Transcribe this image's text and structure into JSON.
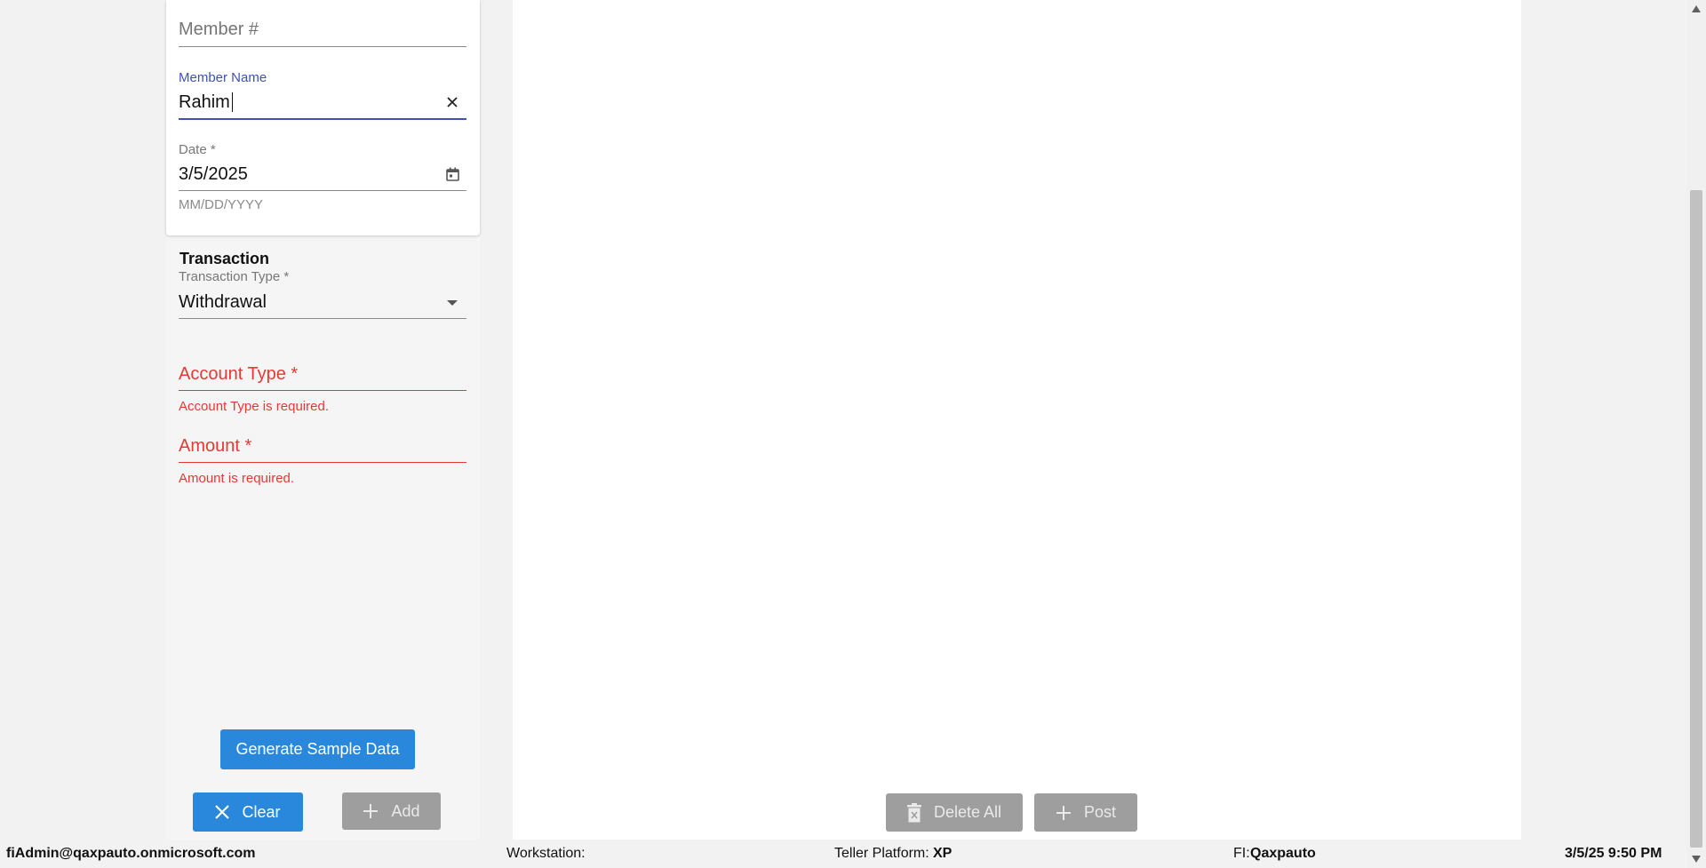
{
  "form": {
    "member_number": {
      "placeholder": "Member #"
    },
    "member_name": {
      "label": "Member Name",
      "value": "Rahim"
    },
    "date": {
      "label": "Date *",
      "value": "3/5/2025",
      "hint": "MM/DD/YYYY"
    }
  },
  "transaction": {
    "title": "Transaction",
    "type": {
      "label": "Transaction Type *",
      "value": "Withdrawal"
    },
    "account_type": {
      "placeholder": "Account Type *",
      "error": "Account Type is required."
    },
    "amount": {
      "placeholder": "Amount *",
      "error": "Amount is required."
    }
  },
  "buttons": {
    "generate": "Generate Sample Data",
    "clear": "Clear",
    "add": "Add",
    "delete_all": "Delete All",
    "post": "Post"
  },
  "status": {
    "user": "fiAdmin@qaxpauto.onmicrosoft.com",
    "workstation_label": "Workstation:",
    "workstation_value": "",
    "platform_label": "Teller Platform:",
    "platform_value": "XP",
    "fi_label": "FI:",
    "fi_value": "Qaxpauto",
    "datetime": "3/5/25 9:50 PM"
  },
  "colors": {
    "primary": "#2a88dc",
    "focus": "#3f51b5",
    "error": "#e53935",
    "disabled": "#9e9e9e"
  },
  "icons": [
    "close-icon",
    "calendar-icon",
    "dropdown-arrow-icon",
    "plus-icon",
    "trash-icon"
  ]
}
